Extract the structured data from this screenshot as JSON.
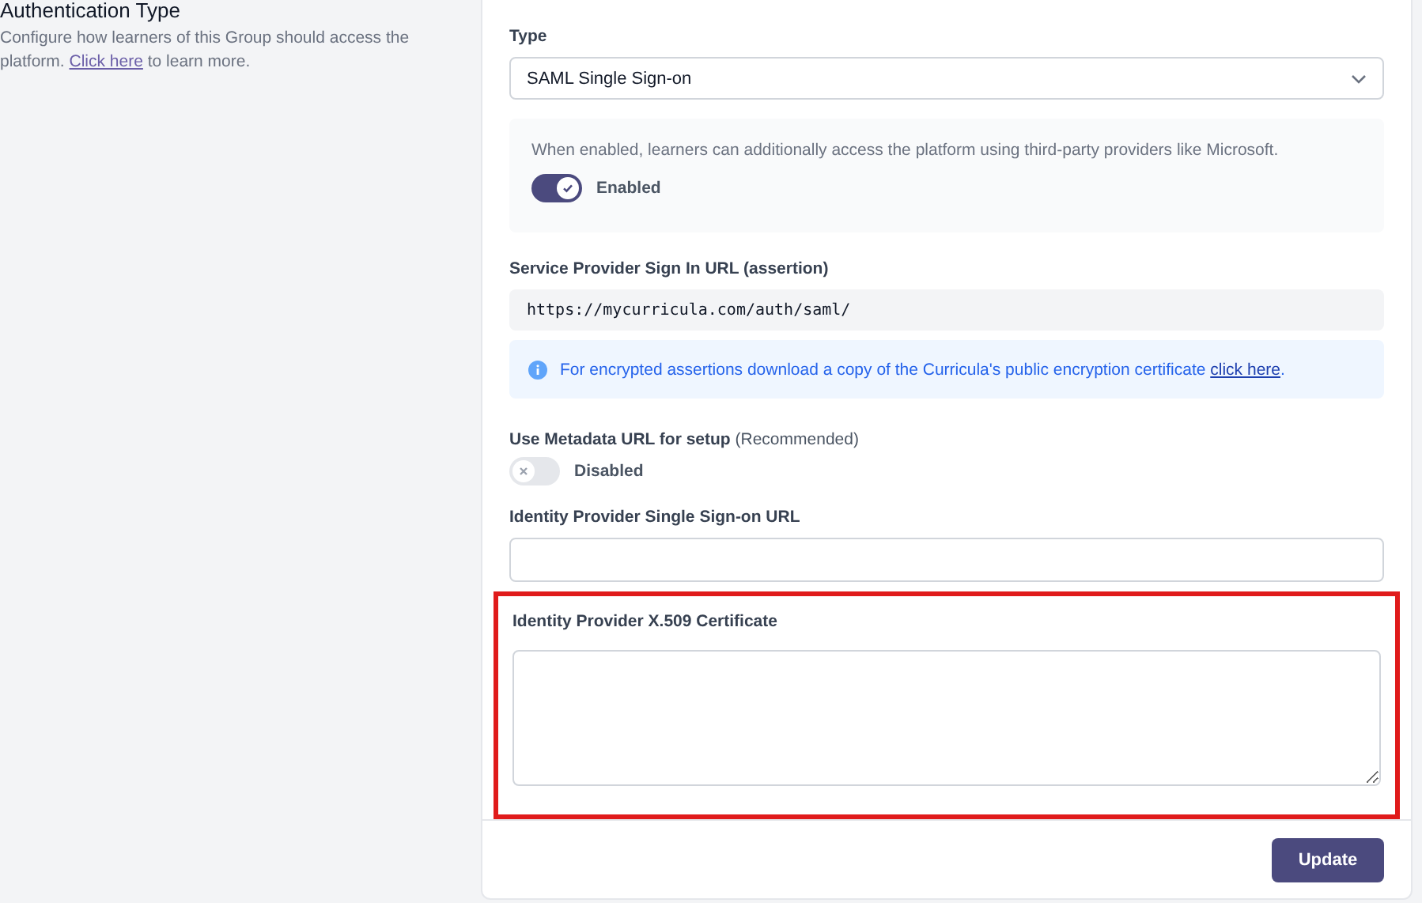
{
  "section": {
    "title": "Authentication Type",
    "description_before": "Configure how learners of this Group should access the platform. ",
    "description_link": "Click here",
    "description_after": " to learn more."
  },
  "type_field": {
    "label": "Type",
    "value": "SAML Single Sign-on"
  },
  "sso_panel": {
    "text": "When enabled, learners can additionally access the platform using third-party providers like Microsoft.",
    "toggle": {
      "on": true,
      "label": "Enabled"
    }
  },
  "sp_url": {
    "label": "Service Provider Sign In URL (assertion)",
    "value": "https://mycurricula.com/auth/saml/"
  },
  "note": {
    "text": "For encrypted assertions download a copy of the Curricula's public encryption certificate ",
    "link": "click here",
    "after": "."
  },
  "metadata": {
    "label": "Use Metadata URL for setup",
    "hint": "(Recommended)",
    "toggle": {
      "on": false,
      "label": "Disabled"
    }
  },
  "idp_url": {
    "label": "Identity Provider Single Sign-on URL"
  },
  "certificate": {
    "label": "Identity Provider X.509 Certificate",
    "highlighted": true
  },
  "update_button": "Update"
}
